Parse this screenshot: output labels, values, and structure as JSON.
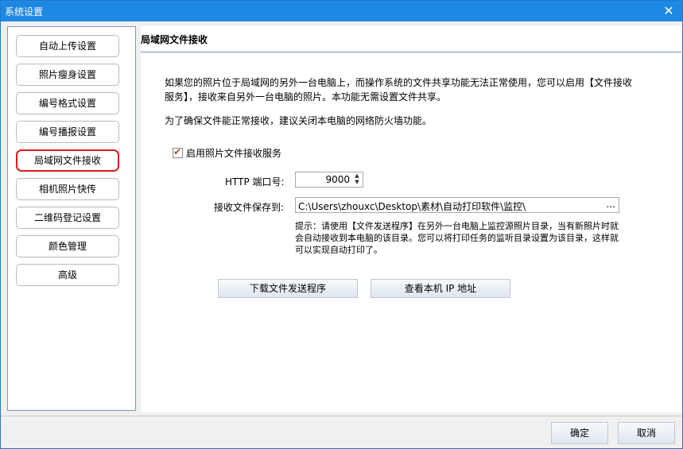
{
  "window": {
    "title": "系统设置",
    "close_icon": "close-icon"
  },
  "sidebar": {
    "items": [
      {
        "label": "自动上传设置"
      },
      {
        "label": "照片瘦身设置"
      },
      {
        "label": "编号格式设置"
      },
      {
        "label": "编号播报设置"
      },
      {
        "label": "局域网文件接收",
        "active": true
      },
      {
        "label": "相机照片快传"
      },
      {
        "label": "二维码登记设置"
      },
      {
        "label": "颜色管理"
      },
      {
        "label": "高级"
      }
    ]
  },
  "main": {
    "title": "局域网文件接收",
    "intro": "如果您的照片位于局域网的另外一台电脑上，而操作系统的文件共享功能无法正常使用，您可以启用【文件接收服务】，接收来自另外一台电脑的照片。本功能无需设置文件共享。",
    "firewall_note": "为了确保文件能正常接收，建议关闭本电脑的网络防火墙功能。",
    "enable_checkbox": {
      "label": "启用照片文件接收服务",
      "checked": true
    },
    "port": {
      "label": "HTTP 端口号:",
      "value": "9000"
    },
    "save_path": {
      "label": "接收文件保存到:",
      "value": "C:\\Users\\zhouxc\\Desktop\\素材\\自动打印软件\\监控\\",
      "browse_label": "..."
    },
    "hint": "提示：请使用【文件发送程序】在另外一台电脑上监控源照片目录，当有新照片时就会自动接收到本电脑的该目录。您可以将打印任务的监听目录设置为该目录，这样就可以实现自动打印了。",
    "download_button": "下载文件发送程序",
    "view_ip_button": "查看本机 IP 地址"
  },
  "footer": {
    "ok_label": "确定",
    "cancel_label": "取消"
  },
  "colors": {
    "titlebar": "#1e88e5",
    "active_border": "#e01c1c",
    "checkmark": "#a0522d"
  }
}
